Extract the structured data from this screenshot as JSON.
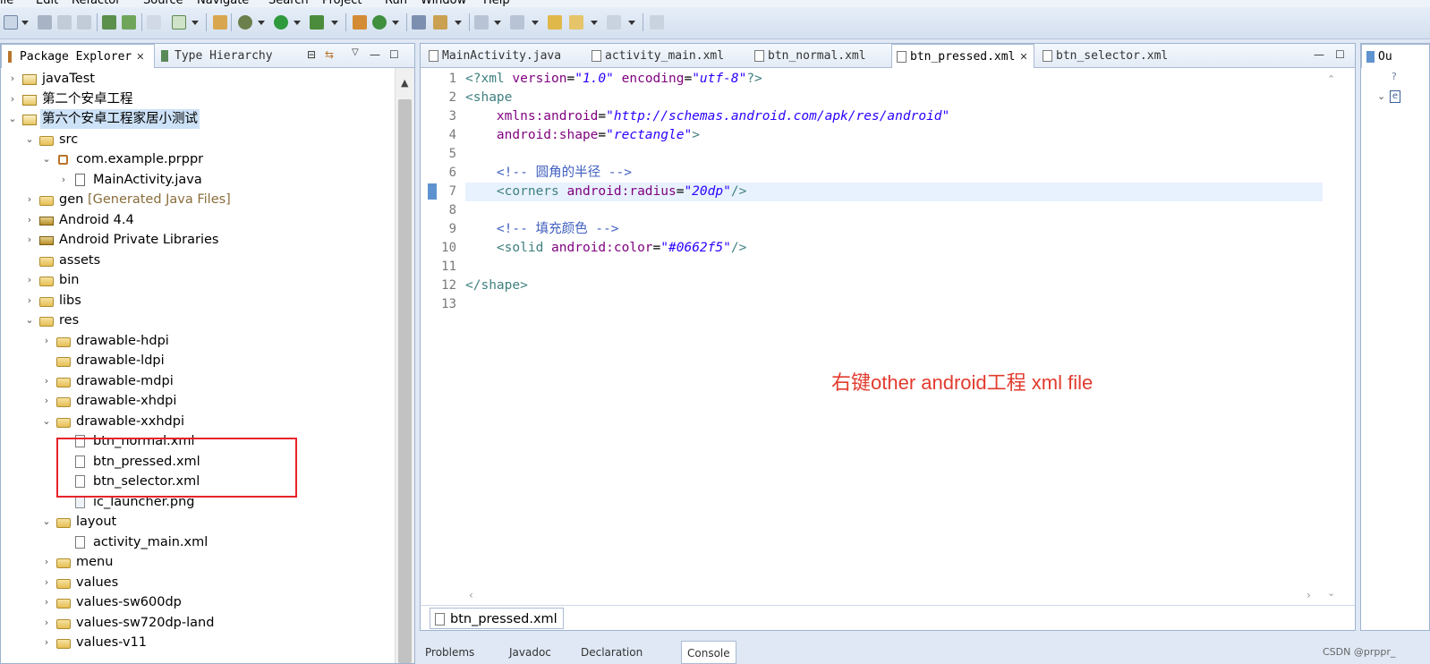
{
  "menubar": {
    "items": [
      "ile",
      "Edit",
      "Refactor",
      "Source",
      "Navigate",
      "Search",
      "Project",
      "Run",
      "Window",
      "Help"
    ]
  },
  "left_panel": {
    "tabs": [
      {
        "label": "Package Explorer",
        "close": "✕"
      },
      {
        "label": "Type Hierarchy"
      }
    ],
    "controls": [
      "⊟",
      "⇆",
      "▽",
      "—",
      "☐"
    ],
    "tree": [
      {
        "label": "javaTest",
        "icon": "project-icon",
        "chevron": "›",
        "level": 0
      },
      {
        "label": "第二个安卓工程",
        "icon": "project-icon",
        "chevron": "›",
        "level": 0
      },
      {
        "label": "第六个安卓工程家居小测试",
        "icon": "project-icon",
        "chevron": "⌄",
        "level": 0,
        "selected": true
      },
      {
        "label": "src",
        "icon": "source-folder-icon",
        "chevron": "⌄",
        "level": 1
      },
      {
        "label": "com.example.prppr",
        "icon": "package-icon",
        "chevron": "⌄",
        "level": 2
      },
      {
        "label": "MainActivity.java",
        "icon": "java-file-icon",
        "chevron": "›",
        "level": 3
      },
      {
        "label": "gen",
        "suffix": "[Generated Java Files]",
        "icon": "source-folder-icon",
        "chevron": "›",
        "level": 1
      },
      {
        "label": "Android 4.4",
        "icon": "library-icon",
        "chevron": "›",
        "level": 1
      },
      {
        "label": "Android Private Libraries",
        "icon": "library-icon",
        "chevron": "›",
        "level": 1
      },
      {
        "label": "assets",
        "icon": "folder-icon",
        "chevron": "",
        "level": 1
      },
      {
        "label": "bin",
        "icon": "folder-icon",
        "chevron": "›",
        "level": 1
      },
      {
        "label": "libs",
        "icon": "folder-icon",
        "chevron": "›",
        "level": 1
      },
      {
        "label": "res",
        "icon": "folder-icon",
        "chevron": "⌄",
        "level": 1
      },
      {
        "label": "drawable-hdpi",
        "icon": "folder-icon",
        "chevron": "›",
        "level": 2
      },
      {
        "label": "drawable-ldpi",
        "icon": "folder-icon",
        "chevron": "",
        "level": 2
      },
      {
        "label": "drawable-mdpi",
        "icon": "folder-icon",
        "chevron": "›",
        "level": 2
      },
      {
        "label": "drawable-xhdpi",
        "icon": "folder-icon",
        "chevron": "›",
        "level": 2
      },
      {
        "label": "drawable-xxhdpi",
        "icon": "folder-icon",
        "chevron": "⌄",
        "level": 2
      },
      {
        "label": "btn_normal.xml",
        "icon": "xml-file-icon",
        "chevron": "",
        "level": 3
      },
      {
        "label": "btn_pressed.xml",
        "icon": "xml-file-icon",
        "chevron": "",
        "level": 3
      },
      {
        "label": "btn_selector.xml",
        "icon": "xml-file-icon",
        "chevron": "",
        "level": 3
      },
      {
        "label": "ic_launcher.png",
        "icon": "image-file-icon",
        "chevron": "",
        "level": 3
      },
      {
        "label": "layout",
        "icon": "folder-icon",
        "chevron": "⌄",
        "level": 2
      },
      {
        "label": "activity_main.xml",
        "icon": "xml-file-icon",
        "chevron": "",
        "level": 3
      },
      {
        "label": "menu",
        "icon": "folder-icon",
        "chevron": "›",
        "level": 2
      },
      {
        "label": "values",
        "icon": "folder-icon",
        "chevron": "›",
        "level": 2
      },
      {
        "label": "values-sw600dp",
        "icon": "folder-icon",
        "chevron": "›",
        "level": 2
      },
      {
        "label": "values-sw720dp-land",
        "icon": "folder-icon",
        "chevron": "›",
        "level": 2
      },
      {
        "label": "values-v11",
        "icon": "folder-icon",
        "chevron": "›",
        "level": 2
      }
    ]
  },
  "editor": {
    "tabs": [
      {
        "label": "MainActivity.java",
        "icon": "java-file-icon",
        "active": false
      },
      {
        "label": "activity_main.xml",
        "icon": "xml-file-icon",
        "active": false
      },
      {
        "label": "btn_normal.xml",
        "icon": "xml-file-icon",
        "active": false
      },
      {
        "label": "btn_pressed.xml",
        "icon": "xml-file-icon",
        "active": true,
        "close": "✕"
      },
      {
        "label": "btn_selector.xml",
        "icon": "xml-file-icon",
        "active": false
      }
    ],
    "controls": [
      "—",
      "☐"
    ],
    "line_numbers": [
      "1",
      "2",
      "3",
      "4",
      "5",
      "6",
      "7",
      "8",
      "9",
      "10",
      "11",
      "12",
      "13"
    ],
    "current_line": 7,
    "bottom_tab": "btn_pressed.xml",
    "annotation": "右键other android工程 xml file"
  },
  "right_panel": {
    "tab_label": "Ou",
    "lines": [
      "?",
      "e"
    ]
  },
  "bottom_strip": {
    "tabs": [
      "Problems",
      "Javadoc",
      "Declaration",
      "Console"
    ]
  },
  "watermark": "CSDN @prppr_"
}
